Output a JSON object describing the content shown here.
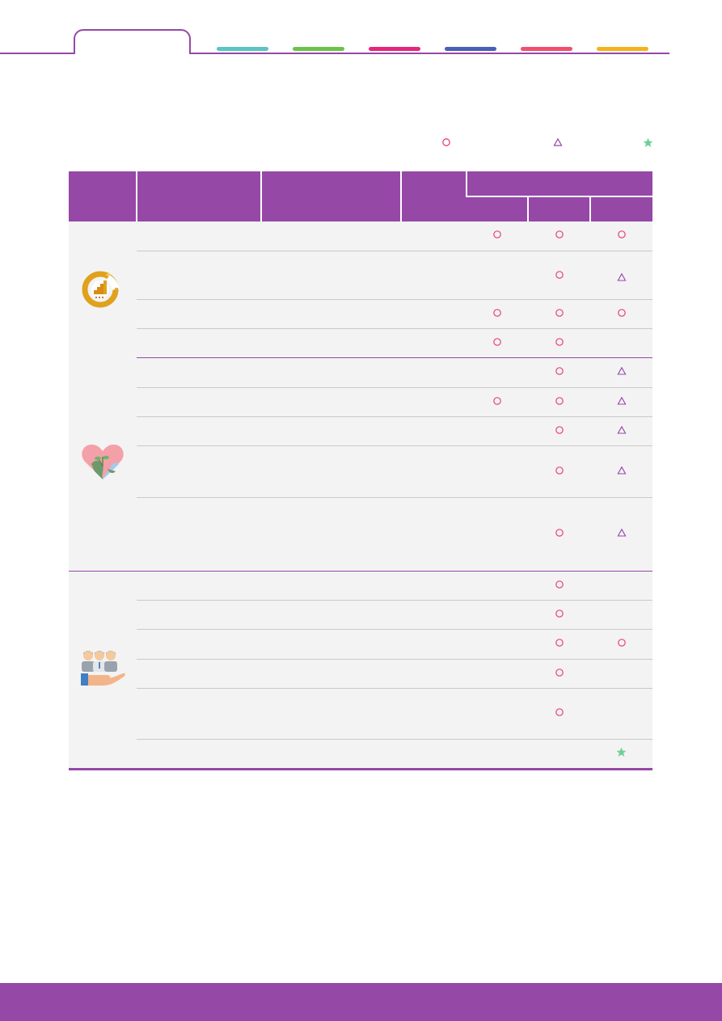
{
  "nav_tabs": [
    {
      "color": "#ffffff",
      "active": true
    },
    {
      "color": "#5bc4c4"
    },
    {
      "color": "#6cc24a"
    },
    {
      "color": "#e5267d"
    },
    {
      "color": "#4a5fb5"
    },
    {
      "color": "#f0506e"
    },
    {
      "color": "#f5b21b"
    }
  ],
  "legend": [
    {
      "icon": "circle-icon",
      "color": "#e8417a"
    },
    {
      "icon": "triangle-icon",
      "color": "#9548a6"
    },
    {
      "icon": "star-icon",
      "color": "#6fcf97"
    }
  ],
  "table": {
    "header_color": "#9548a6",
    "sections": [
      {
        "icon": "growth-chart-icon",
        "rows": [
          {
            "marks": [
              "circle",
              "circle",
              "circle"
            ]
          },
          {
            "marks": [
              "",
              "circle",
              "triangle"
            ]
          },
          {
            "marks": [
              "circle",
              "circle",
              "circle"
            ]
          },
          {
            "marks": [
              "circle",
              "circle",
              ""
            ]
          }
        ]
      },
      {
        "icon": "heart-earth-icon",
        "rows": [
          {
            "marks": [
              "",
              "circle",
              "triangle"
            ]
          },
          {
            "marks": [
              "circle",
              "circle",
              "triangle"
            ]
          },
          {
            "marks": [
              "",
              "circle",
              "triangle"
            ]
          },
          {
            "marks": [
              "",
              "circle",
              "triangle"
            ]
          },
          {
            "marks": [
              "",
              "circle",
              "triangle"
            ]
          }
        ]
      },
      {
        "icon": "people-in-hand-icon",
        "rows": [
          {
            "marks": [
              "",
              "circle",
              ""
            ]
          },
          {
            "marks": [
              "",
              "circle",
              ""
            ]
          },
          {
            "marks": [
              "",
              "circle",
              "circle"
            ]
          },
          {
            "marks": [
              "",
              "circle",
              ""
            ]
          },
          {
            "marks": [
              "",
              "circle",
              ""
            ]
          },
          {
            "marks": [
              "",
              "",
              "star"
            ]
          }
        ]
      }
    ]
  },
  "footer_color": "#9548a6"
}
